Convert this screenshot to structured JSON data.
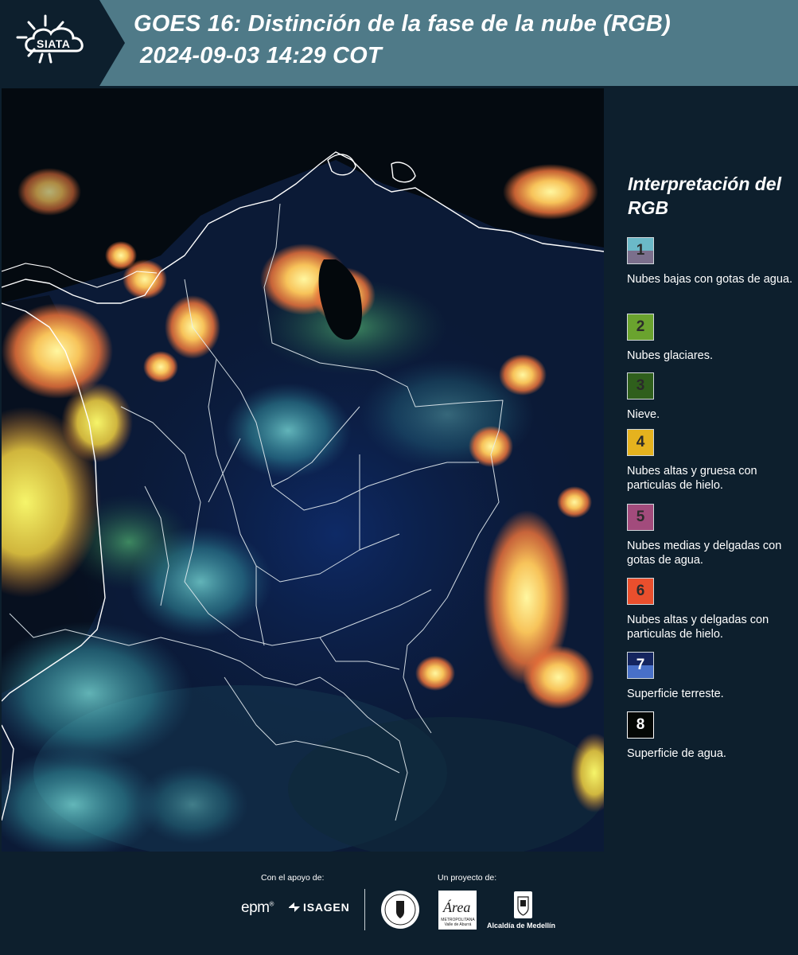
{
  "header": {
    "logo_text": "SIATA",
    "title": "GOES 16: Distinción de la fase de la nube (RGB)",
    "datetime": "2024-09-03 14:29 COT",
    "background_color": "#4f7a88"
  },
  "map": {
    "description_layers": [
      "satellite-rgb-composite",
      "country-boundaries",
      "department-boundaries",
      "coastline"
    ]
  },
  "legend": {
    "title": "Interpretación del RGB",
    "items": [
      {
        "number": "1",
        "label": "Nubes bajas con gotas de agua.",
        "color_top": "#6bb9c8",
        "color_bottom": "#7b6f8c"
      },
      {
        "number": "2",
        "label": "Nubes glaciares.",
        "color": "#6aa32e"
      },
      {
        "number": "3",
        "label": "Nieve.",
        "color": "#2f5f1c"
      },
      {
        "number": "4",
        "label": "Nubes altas y gruesa con particulas de hielo.",
        "color": "#e5b21e"
      },
      {
        "number": "5",
        "label": "Nubes medias y delgadas con gotas de agua.",
        "color": "#a24b7c"
      },
      {
        "number": "6",
        "label": "Nubes altas y delgadas con particulas de hielo.",
        "color": "#ea4f2d"
      },
      {
        "number": "7",
        "label": "Superficie terreste.",
        "color_top": "#14255f",
        "color_bottom": "#4870c8"
      },
      {
        "number": "8",
        "label": "Superficie de agua.",
        "color": "#040704"
      }
    ]
  },
  "footer": {
    "support_label": "Con el apoyo de:",
    "project_label": "Un proyecto de:",
    "sponsors": [
      "epm",
      "ISAGEN"
    ],
    "partners": [
      "Área Metropolitana Valle de Aburrá",
      "Alcaldía de Medellín"
    ],
    "area_logo_text": "Área",
    "area_logo_sub": "METROPOLITANA Valle de Aburrá",
    "alcaldia_text": "Alcaldía de Medellín"
  }
}
